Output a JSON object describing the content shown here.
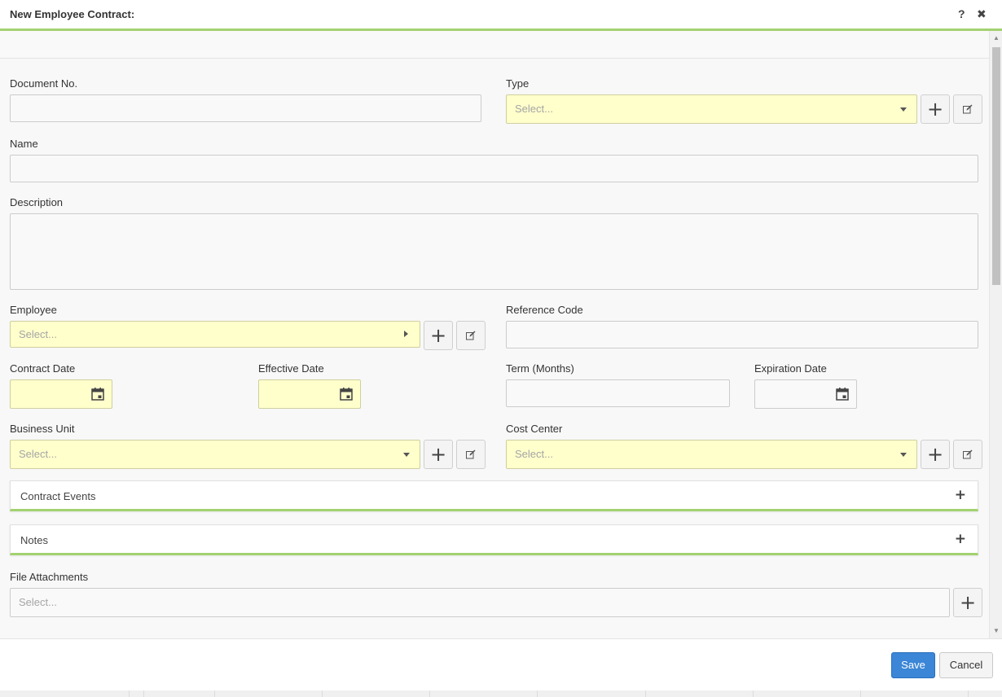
{
  "modal": {
    "title": "New Employee Contract:",
    "help_icon": "?",
    "close_icon": "✖"
  },
  "fields": {
    "document_no": {
      "label": "Document No.",
      "value": ""
    },
    "type": {
      "label": "Type",
      "placeholder": "Select..."
    },
    "name": {
      "label": "Name",
      "value": ""
    },
    "description": {
      "label": "Description",
      "value": ""
    },
    "employee": {
      "label": "Employee",
      "placeholder": "Select..."
    },
    "reference_code": {
      "label": "Reference Code",
      "value": ""
    },
    "contract_date": {
      "label": "Contract Date",
      "value": ""
    },
    "effective_date": {
      "label": "Effective Date",
      "value": ""
    },
    "term_months": {
      "label": "Term (Months)",
      "value": ""
    },
    "expiration_date": {
      "label": "Expiration Date",
      "value": ""
    },
    "business_unit": {
      "label": "Business Unit",
      "placeholder": "Select..."
    },
    "cost_center": {
      "label": "Cost Center",
      "placeholder": "Select..."
    },
    "file_attachments": {
      "label": "File Attachments",
      "placeholder": "Select..."
    }
  },
  "panels": [
    {
      "title": "Contract Events",
      "toggle": "+"
    },
    {
      "title": "Notes",
      "toggle": "+"
    }
  ],
  "buttons": {
    "add": "+",
    "save": "Save",
    "cancel": "Cancel"
  },
  "icons": {
    "add": "plus-icon",
    "edit": "edit-icon",
    "calendar": "calendar-icon",
    "dropdown": "chevron-down-icon",
    "expand": "chevron-right-icon"
  },
  "colors": {
    "required_field_bg": "#ffffcc",
    "accent_green": "#a3d171",
    "primary_button": "#3b86d6"
  }
}
